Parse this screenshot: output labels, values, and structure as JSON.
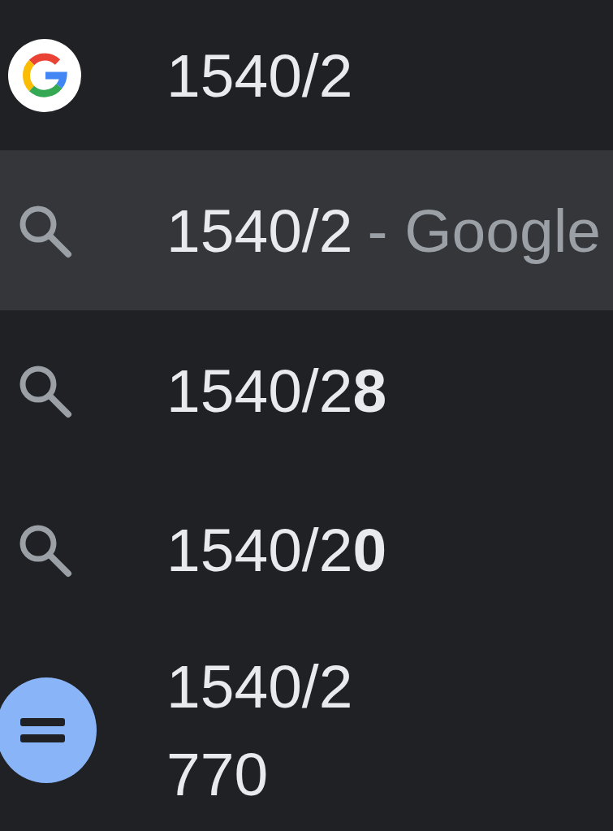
{
  "suggestions": [
    {
      "kind": "google",
      "text": "1540/2",
      "selected": false
    },
    {
      "kind": "search",
      "text": "1540/2",
      "description": "- Google",
      "selected": true
    },
    {
      "kind": "search",
      "text": "1540/2**8**",
      "selected": false
    },
    {
      "kind": "search",
      "text": "1540/2**0**",
      "selected": false
    },
    {
      "kind": "calculator",
      "text": "1540/2",
      "answer": "770",
      "selected": false
    }
  ]
}
